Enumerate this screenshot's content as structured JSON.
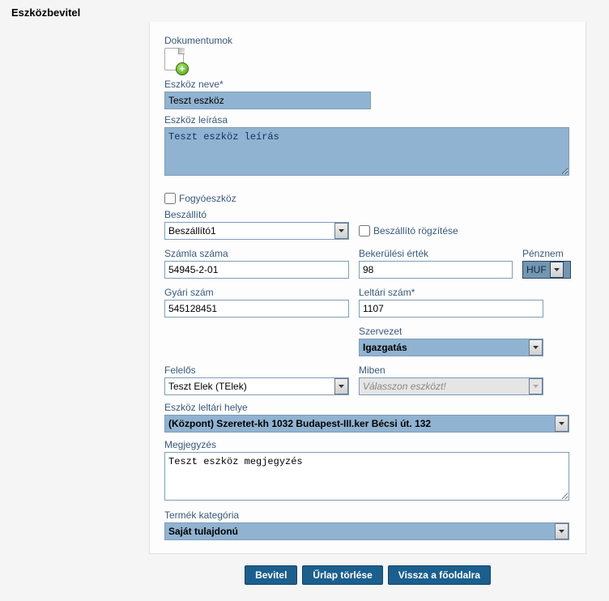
{
  "page_title": "Eszközbevitel",
  "labels": {
    "documents": "Dokumentumok",
    "tool_name": "Eszköz neve*",
    "tool_desc": "Eszköz leírása",
    "consumable": "Fogyóeszköz",
    "supplier": "Beszállító",
    "supplier_lock": "Beszállító rögzítése",
    "invoice_no": "Számla száma",
    "cost": "Bekerülési érték",
    "currency": "Pénznem",
    "serial": "Gyári szám",
    "inventory_no": "Leltári szám*",
    "org": "Szervezet",
    "responsible": "Felelős",
    "in_what": "Miben",
    "inv_location": "Eszköz leltári helye",
    "remark": "Megjegyzés",
    "category": "Termék kategória"
  },
  "values": {
    "tool_name": "Teszt eszköz",
    "tool_desc": "Teszt eszköz leírás",
    "supplier": "Beszállító1",
    "invoice_no": "54945-2-01",
    "cost": "98",
    "currency": "HUF",
    "serial": "545128451",
    "inventory_no": "1107",
    "org": "Igazgatás",
    "responsible": "Teszt Elek (TElek)",
    "in_what_placeholder": "Válasszon eszközt!",
    "inv_location": "(Központ) Szeretet-kh 1032 Budapest-III.ker Bécsi út. 132",
    "remark": "Teszt eszköz megjegyzés",
    "category": "Saját tulajdonú"
  },
  "buttons": {
    "submit": "Bevitel",
    "clear": "Űrlap törlése",
    "back": "Vissza a főoldalra"
  },
  "icons": {
    "add_doc": "add-document"
  }
}
